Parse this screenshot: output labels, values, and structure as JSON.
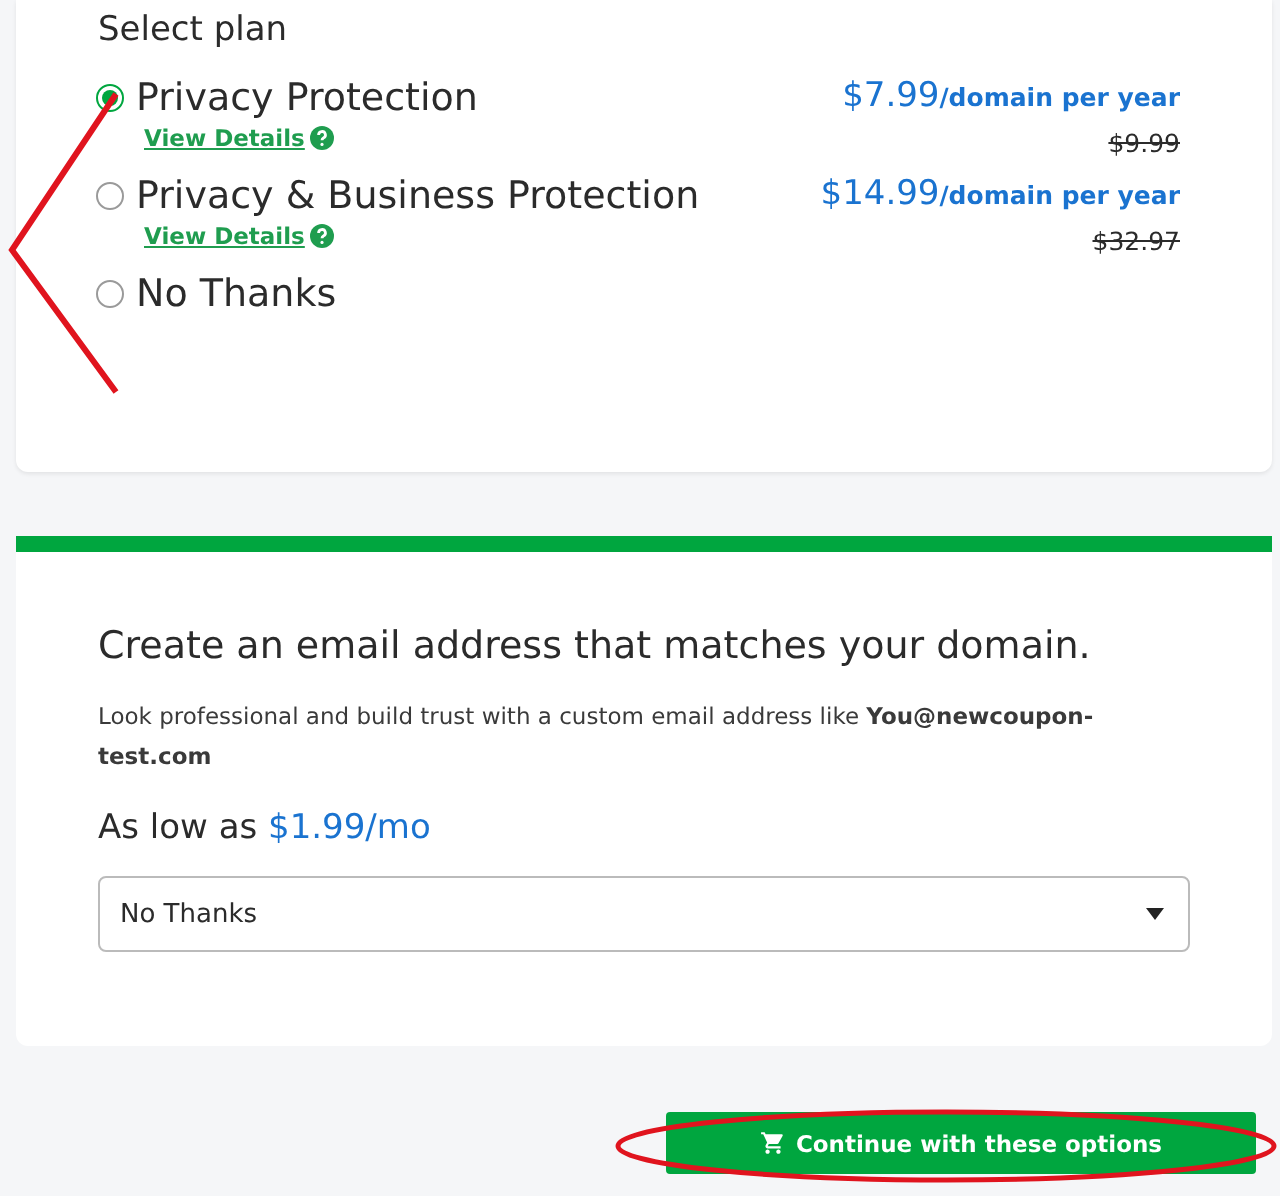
{
  "plan_section": {
    "title": "Select plan",
    "plans": [
      {
        "name": "Privacy Protection",
        "selected": true,
        "details_link": "View Details",
        "price": "$7.99",
        "price_unit": "/domain per year",
        "old_price": "$9.99"
      },
      {
        "name": "Privacy & Business Protection",
        "selected": false,
        "details_link": "View Details",
        "price": "$14.99",
        "price_unit": "/domain per year",
        "old_price": "$32.97"
      },
      {
        "name": "No Thanks",
        "selected": false
      }
    ]
  },
  "email_section": {
    "title": "Create an email address that matches your domain.",
    "description": "Look professional and build trust with a custom email address like **You@newcoupon-test.com**",
    "price_prefix": "As low as",
    "price": "$1.99/mo",
    "select_value": "No Thanks"
  },
  "continue_button": {
    "label": "Continue with these options"
  }
}
